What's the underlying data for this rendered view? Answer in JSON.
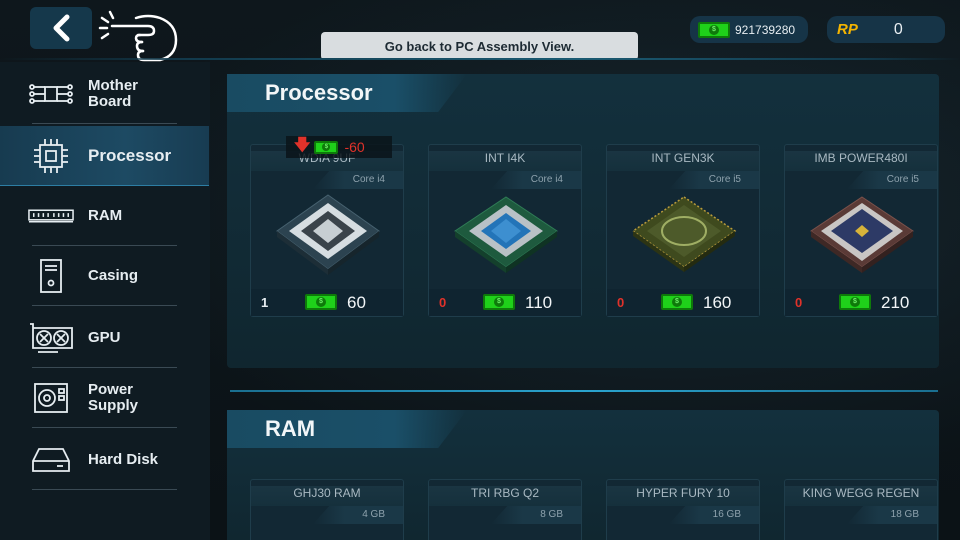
{
  "topbar": {
    "tooltip": "Go back to PC Assembly View.",
    "money": "921739280",
    "rp_label": "RP",
    "rp_value": "0"
  },
  "sidebar": {
    "items": [
      {
        "label": "Mother Board",
        "icon": "motherboard-icon"
      },
      {
        "label": "Processor",
        "icon": "processor-icon",
        "active": true
      },
      {
        "label": "RAM",
        "icon": "ram-icon"
      },
      {
        "label": "Casing",
        "icon": "casing-icon"
      },
      {
        "label": "GPU",
        "icon": "gpu-icon"
      },
      {
        "label": "Power Supply",
        "icon": "power-supply-icon"
      },
      {
        "label": "Hard Disk",
        "icon": "hard-disk-icon"
      }
    ]
  },
  "processor_section": {
    "title": "Processor",
    "price_change": "-60",
    "cards": [
      {
        "name": "WDIA 9UF",
        "tag": "Core i4",
        "qty": "1",
        "price": "60"
      },
      {
        "name": "INT I4K",
        "tag": "Core i4",
        "qty": "0",
        "price": "110"
      },
      {
        "name": "INT GEN3K",
        "tag": "Core i5",
        "qty": "0",
        "price": "160"
      },
      {
        "name": "IMB POWER480I",
        "tag": "Core i5",
        "qty": "0",
        "price": "210"
      }
    ]
  },
  "ram_section": {
    "title": "RAM",
    "cards": [
      {
        "name": "GHJ30 RAM",
        "tag": "4 GB"
      },
      {
        "name": "TRI RBG Q2",
        "tag": "8 GB"
      },
      {
        "name": "HYPER FURY 10",
        "tag": "16 GB"
      },
      {
        "name": "KING WEGG REGEN",
        "tag": "18 GB"
      }
    ]
  },
  "colors": {
    "accent": "#2aa4cf",
    "money_green": "#1fd11a",
    "negative_red": "#e0322a",
    "rp_gold": "#f4b400"
  }
}
